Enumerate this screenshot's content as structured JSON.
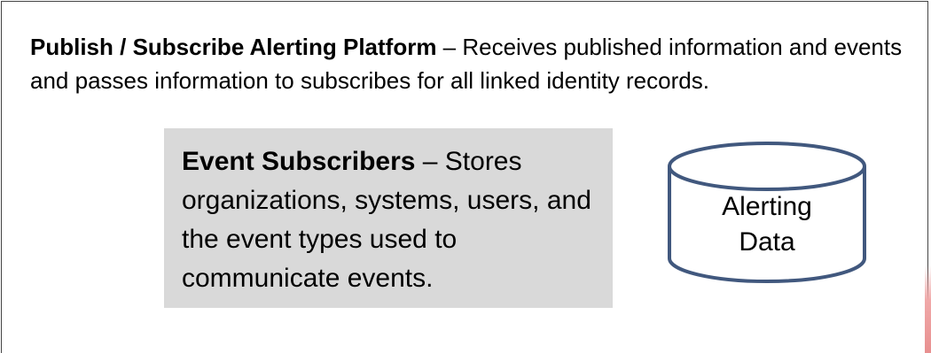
{
  "platform": {
    "title": "Publish / Subscribe Alerting Platform",
    "description": " – Receives published information and events and passes information to subscribes for all linked identity records."
  },
  "subscribers": {
    "title": "Event Subscribers",
    "description": " – Stores organizations, systems,  users, and the event types  used to communicate events."
  },
  "datastore": {
    "line1": "Alerting",
    "line2": "Data"
  },
  "colors": {
    "box_fill": "#d9d9d9",
    "cylinder_stroke": "#41587e",
    "frame_border": "#444444",
    "edge_accent": "#e89090"
  }
}
